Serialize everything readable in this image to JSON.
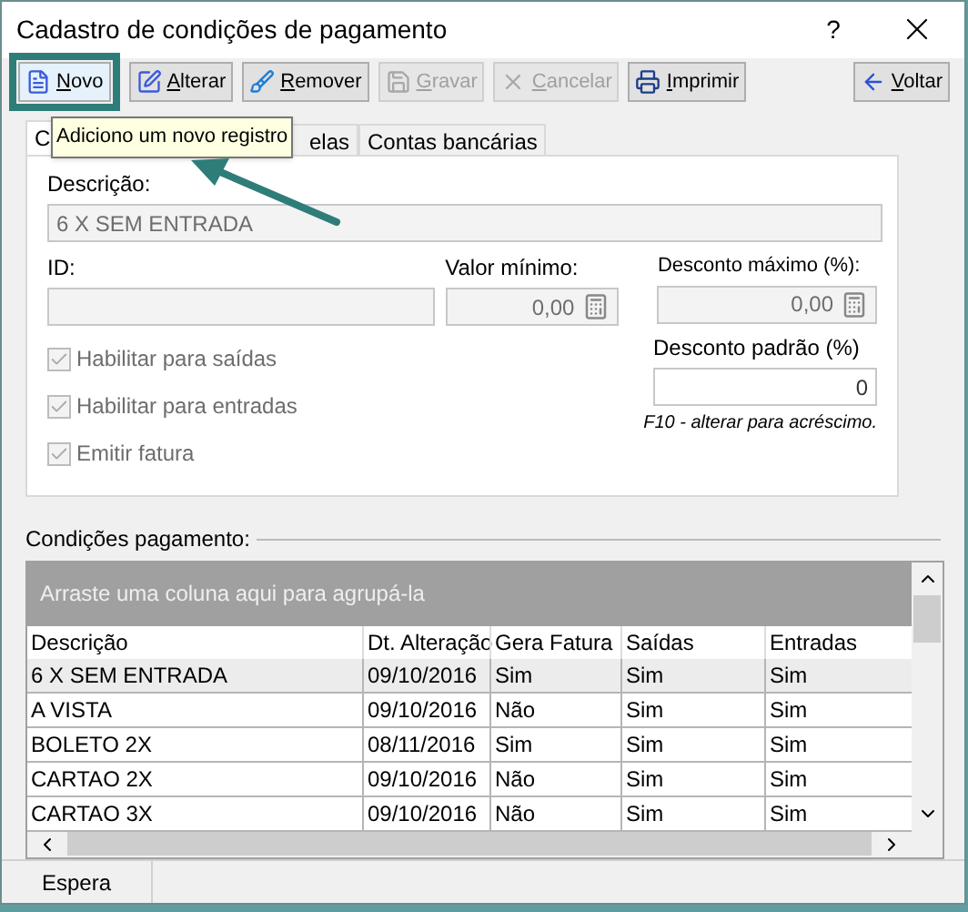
{
  "window": {
    "title": "Cadastro de condições de pagamento",
    "help": "?"
  },
  "toolbar": [
    {
      "label": "Novo",
      "kind": "new",
      "disabled": false,
      "highlighted": true
    },
    {
      "label": "Alterar",
      "kind": "edit",
      "disabled": false,
      "highlighted": false
    },
    {
      "label": "Remover",
      "kind": "remove",
      "disabled": false,
      "highlighted": false
    },
    {
      "label": "Gravar",
      "kind": "save",
      "disabled": true,
      "highlighted": false
    },
    {
      "label": "Cancelar",
      "kind": "cancel",
      "disabled": true,
      "highlighted": false
    },
    {
      "label": "Imprimir",
      "kind": "print",
      "disabled": false,
      "highlighted": false
    },
    {
      "label": "Voltar",
      "kind": "back",
      "disabled": false,
      "highlighted": false
    }
  ],
  "tooltip": "Adiciono um novo registro",
  "tabs": [
    {
      "label": "C",
      "selected": true
    },
    {
      "label": "elas",
      "selected": false
    },
    {
      "label": "Contas bancárias",
      "selected": false
    }
  ],
  "form": {
    "descricao": {
      "label": "Descrição:",
      "value": "6 X SEM ENTRADA",
      "disabled": true
    },
    "id": {
      "label": "ID:",
      "disabled": true
    },
    "valor_minimo": {
      "label": "Valor mínimo:",
      "value": "0,00",
      "disabled": true
    },
    "desconto_maximo": {
      "label": "Desconto máximo (%):",
      "value": "0,00",
      "disabled": true
    },
    "desconto_padrao": {
      "label": "Desconto padrão (%)",
      "value": "0",
      "disabled": false
    },
    "hint": "F10 - alterar para acréscimo.",
    "checkboxes": [
      {
        "label": "Habilitar para saídas",
        "checked": true,
        "disabled": true
      },
      {
        "label": "Habilitar para entradas",
        "checked": true,
        "disabled": true
      },
      {
        "label": "Emitir fatura",
        "checked": true,
        "disabled": true
      }
    ]
  },
  "grid": {
    "title": "Condições pagamento:",
    "group_hint": "Arraste uma coluna aqui para agrupá-la",
    "columns": [
      "Descrição",
      "Dt. Alteração",
      "Gera Fatura",
      "Saídas",
      "Entradas"
    ],
    "rows": [
      {
        "cells": [
          "6 X SEM ENTRADA",
          "09/10/2016",
          "Sim",
          "Sim",
          "Sim"
        ],
        "selected": true
      },
      {
        "cells": [
          "A VISTA",
          "09/10/2016",
          "Não",
          "Sim",
          "Sim"
        ],
        "selected": false
      },
      {
        "cells": [
          "BOLETO 2X",
          "08/11/2016",
          "Sim",
          "Sim",
          "Sim"
        ],
        "selected": false
      },
      {
        "cells": [
          "CARTAO 2X",
          "09/10/2016",
          "Não",
          "Sim",
          "Sim"
        ],
        "selected": false
      },
      {
        "cells": [
          "CARTAO 3X",
          "09/10/2016",
          "Não",
          "Sim",
          "Sim"
        ],
        "selected": false
      }
    ]
  },
  "status_bar": [
    "Espera"
  ]
}
